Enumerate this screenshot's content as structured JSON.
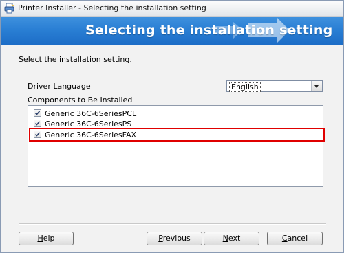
{
  "window": {
    "title": "Printer Installer - Selecting the installation setting",
    "banner_title": "Selecting the installation setting",
    "accent_color": "#2a7fd4"
  },
  "main": {
    "instruction": "Select the installation setting.",
    "driver_language_label": "Driver Language",
    "driver_language_value": "English",
    "components_label": "Components to Be Installed",
    "components": [
      {
        "label": "Generic 36C-6SeriesPCL",
        "checked": true
      },
      {
        "label": "Generic 36C-6SeriesPS",
        "checked": true
      },
      {
        "label": "Generic 36C-6SeriesFAX",
        "checked": true
      }
    ]
  },
  "buttons": {
    "help": {
      "mnemonic": "H",
      "rest": "elp"
    },
    "previous": {
      "mnemonic": "P",
      "rest": "revious"
    },
    "next": {
      "mnemonic": "N",
      "rest": "ext"
    },
    "cancel": {
      "mnemonic": "C",
      "rest": "ancel"
    }
  },
  "icons": {
    "title_icon": "printer-installer-icon",
    "banner_graphic": "arrow-icon",
    "dropdown": "chevron-down-icon",
    "checkbox": "checkmark-icon"
  }
}
